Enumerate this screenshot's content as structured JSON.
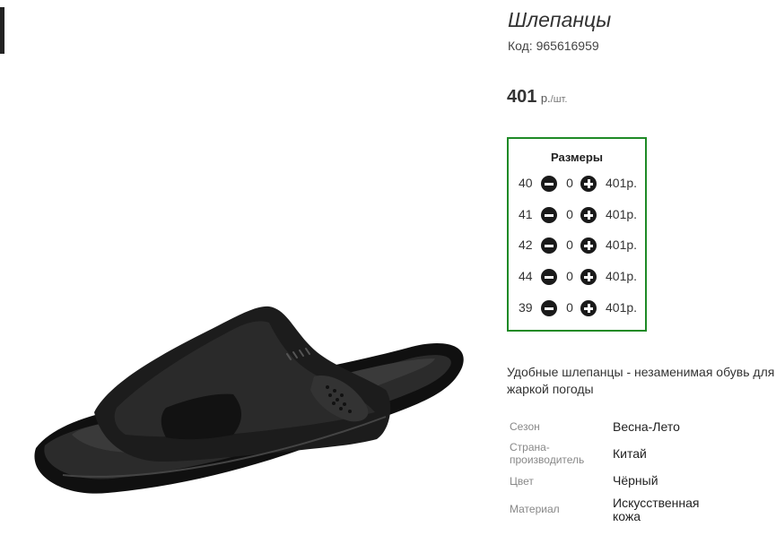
{
  "product": {
    "title": "Шлепанцы",
    "code_label": "Код:",
    "code_value": "965616959",
    "price_value": "401",
    "price_unit": "р.",
    "price_per": "/шт."
  },
  "sizes": {
    "title": "Размеры",
    "rows": [
      {
        "size": "40",
        "qty": "0",
        "price": "401р."
      },
      {
        "size": "41",
        "qty": "0",
        "price": "401р."
      },
      {
        "size": "42",
        "qty": "0",
        "price": "401р."
      },
      {
        "size": "44",
        "qty": "0",
        "price": "401р."
      },
      {
        "size": "39",
        "qty": "0",
        "price": "401р."
      }
    ]
  },
  "description": {
    "line1": "Удобные шлепанцы - незаменимая обувь для",
    "line2": "жаркой погоды"
  },
  "specs": [
    {
      "label_lines": [
        "Сезон"
      ],
      "value_lines": [
        "Весна-Лето"
      ]
    },
    {
      "label_lines": [
        "Страна-",
        "производитель"
      ],
      "value_lines": [
        "Китай"
      ]
    },
    {
      "label_lines": [
        "Цвет"
      ],
      "value_lines": [
        "Чёрный"
      ]
    },
    {
      "label_lines": [
        "Материал"
      ],
      "value_lines": [
        "Искусственная",
        "кожа"
      ]
    }
  ],
  "icons": {
    "minus": "minus-circle-icon",
    "plus": "plus-circle-icon"
  },
  "colors": {
    "sizes_border": "#1e8a26",
    "button": "#1a1a1a"
  }
}
